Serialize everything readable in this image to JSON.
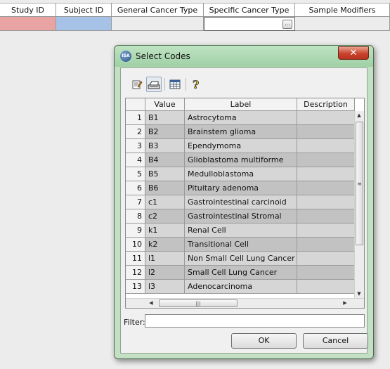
{
  "spreadsheet": {
    "columns": [
      "Study ID",
      "Subject ID",
      "General Cancer Type",
      "Specific Cancer Type",
      "Sample Modifiers"
    ],
    "edit_button_label": "..."
  },
  "dialog": {
    "title": "Select Codes",
    "close_label": "x",
    "table": {
      "columns": [
        "Value",
        "Label",
        "Description"
      ],
      "rows": [
        {
          "num": "1",
          "value": "B1",
          "label": "Astrocytoma",
          "description": ""
        },
        {
          "num": "2",
          "value": "B2",
          "label": "Brainstem glioma",
          "description": ""
        },
        {
          "num": "3",
          "value": "B3",
          "label": "Ependymoma",
          "description": ""
        },
        {
          "num": "4",
          "value": "B4",
          "label": "Glioblastoma multiforme",
          "description": ""
        },
        {
          "num": "5",
          "value": "B5",
          "label": "Medulloblastoma",
          "description": ""
        },
        {
          "num": "6",
          "value": "B6",
          "label": "Pituitary adenoma",
          "description": ""
        },
        {
          "num": "7",
          "value": "c1",
          "label": "Gastrointestinal carcinoid",
          "description": ""
        },
        {
          "num": "8",
          "value": "c2",
          "label": "Gastrointestinal Stromal",
          "description": ""
        },
        {
          "num": "9",
          "value": "k1",
          "label": "Renal Cell",
          "description": ""
        },
        {
          "num": "10",
          "value": "k2",
          "label": "Transitional Cell",
          "description": ""
        },
        {
          "num": "11",
          "value": "l1",
          "label": "Non Small Cell Lung Cancer",
          "description": ""
        },
        {
          "num": "12",
          "value": "l2",
          "label": "Small Cell Lung Cancer",
          "description": ""
        },
        {
          "num": "13",
          "value": "l3",
          "label": "Adenocarcinoma",
          "description": ""
        }
      ]
    },
    "filter_label": "Filter:",
    "filter_value": "",
    "ok_label": "OK",
    "cancel_label": "Cancel",
    "toolbar_icons": [
      "edit-icon",
      "printer-icon",
      "table-icon",
      "help-icon"
    ],
    "colors": {
      "titlebar": "#a9d6ae",
      "close": "#c8432d",
      "row_odd": "#d6d6d6",
      "row_even": "#c2c2c2"
    }
  }
}
